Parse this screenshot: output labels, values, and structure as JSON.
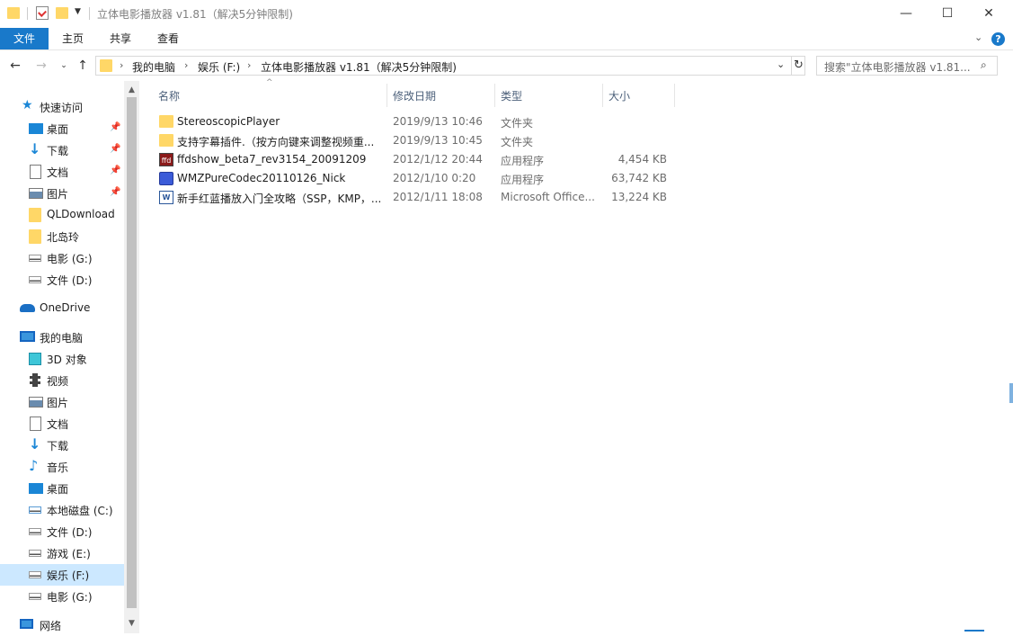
{
  "window": {
    "title": "立体电影播放器 v1.81（解决5分钟限制)",
    "minimize": "—",
    "maximize": "☐",
    "close": "✕"
  },
  "ribbon": {
    "tabs": [
      "文件",
      "主页",
      "共享",
      "查看"
    ]
  },
  "address": {
    "crumbs": [
      "我的电脑",
      "娱乐 (F:)",
      "立体电影播放器 v1.81（解决5分钟限制)"
    ]
  },
  "search": {
    "placeholder": "搜索\"立体电影播放器 v1.81..."
  },
  "nav": {
    "quick_access": "快速访问",
    "quick_items": [
      "桌面",
      "下载",
      "文档",
      "图片",
      "QLDownload",
      "北岛玲",
      "电影 (G:)",
      "文件 (D:)"
    ],
    "onedrive": "OneDrive",
    "this_pc": "我的电脑",
    "pc_items": [
      "3D 对象",
      "视频",
      "图片",
      "文档",
      "下载",
      "音乐",
      "桌面",
      "本地磁盘 (C:)",
      "文件 (D:)",
      "游戏 (E:)",
      "娱乐 (F:)",
      "电影 (G:)"
    ],
    "network": "网络"
  },
  "columns": {
    "name": "名称",
    "date": "修改日期",
    "type": "类型",
    "size": "大小"
  },
  "files": [
    {
      "name": "StereoscopicPlayer",
      "date": "2019/9/13 10:46",
      "type": "文件夹",
      "size": "",
      "icon": "folder-icon"
    },
    {
      "name": "支持字幕插件.（按方向键来调整视频重...",
      "date": "2019/9/13 10:45",
      "type": "文件夹",
      "size": "",
      "icon": "folder-icon"
    },
    {
      "name": "ffdshow_beta7_rev3154_20091209",
      "date": "2012/1/12 20:44",
      "type": "应用程序",
      "size": "4,454 KB",
      "icon": "ffdshow-app-icon"
    },
    {
      "name": "WMZPureCodec20110126_Nick",
      "date": "2012/1/10 0:20",
      "type": "应用程序",
      "size": "63,742 KB",
      "icon": "codec-app-icon"
    },
    {
      "name": "新手红蓝播放入门全攻略（SSP，KMP，...",
      "date": "2012/1/11 18:08",
      "type": "Microsoft Office...",
      "size": "13,224 KB",
      "icon": "word-doc-icon"
    }
  ],
  "colors": {
    "file_tab": "#1979ca",
    "selection": "#cce8ff",
    "header_text": "#4c607a"
  }
}
